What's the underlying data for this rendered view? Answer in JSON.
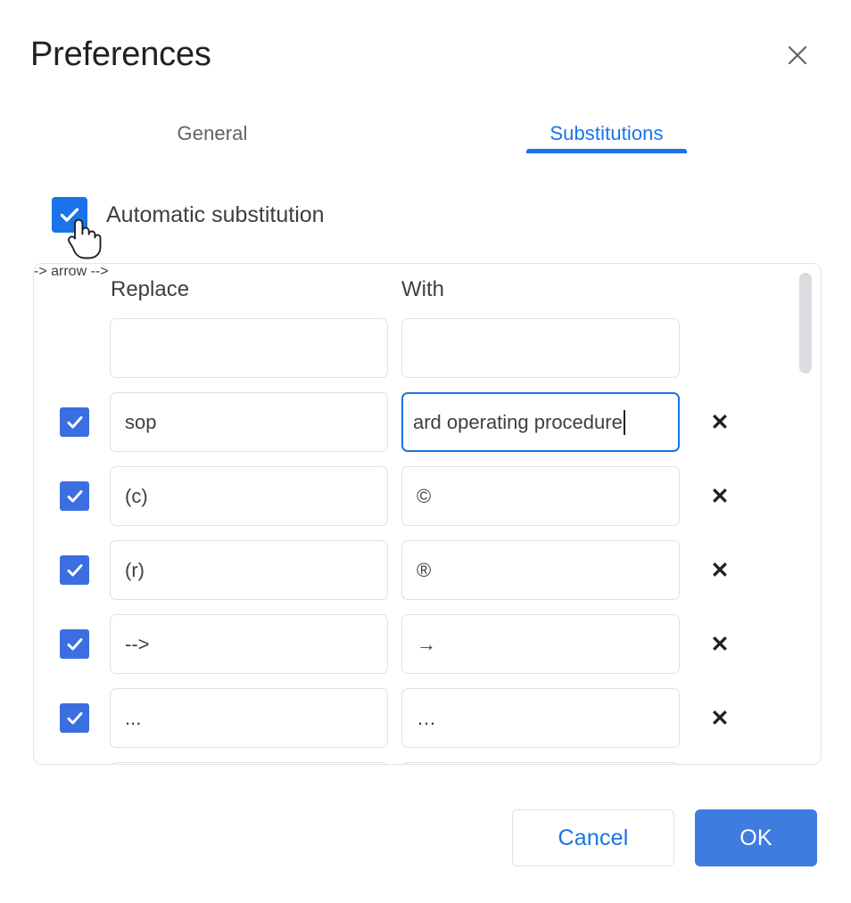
{
  "dialog": {
    "title": "Preferences",
    "close_icon": "close-icon"
  },
  "tabs": [
    {
      "label": "General",
      "selected": false
    },
    {
      "label": "Substitutions",
      "selected": true
    }
  ],
  "automatic_substitution": {
    "label": "Automatic substitution",
    "checked": true,
    "checkbox_color": "#1a73e8"
  },
  "table": {
    "headers": {
      "replace": "Replace",
      "with": "With"
    },
    "rows": [
      {
        "checkbox": null,
        "replace": "",
        "with": "",
        "delete": null,
        "blank": true
      },
      {
        "checkbox": true,
        "replace": "sop",
        "with": "ard operating procedure",
        "with_clipped": true,
        "focused_field": "with",
        "delete": "✕"
      },
      {
        "checkbox": true,
        "replace": "(c)",
        "with": "©",
        "delete": "✕"
      },
      {
        "checkbox": true,
        "replace": "(r)",
        "with": "®",
        "delete": "✕"
      },
      {
        "checkbox": true,
        "replace": "-->",
        "with": "→",
        "delete": "✕"
      },
      {
        "checkbox": true,
        "replace": "...",
        "with": "…",
        "delete": "✕"
      },
      {
        "checkbox": true,
        "replace": "",
        "with": "",
        "delete": "✕",
        "partial": true
      }
    ],
    "scrollbar": {
      "position": "top",
      "thumb_color": "#dadce0"
    }
  },
  "footer": {
    "cancel_label": "Cancel",
    "ok_label": "OK",
    "ok_color": "#3f7ce0",
    "cancel_text_color": "#1a73e8"
  },
  "cursor": {
    "type": "pointing-hand"
  }
}
